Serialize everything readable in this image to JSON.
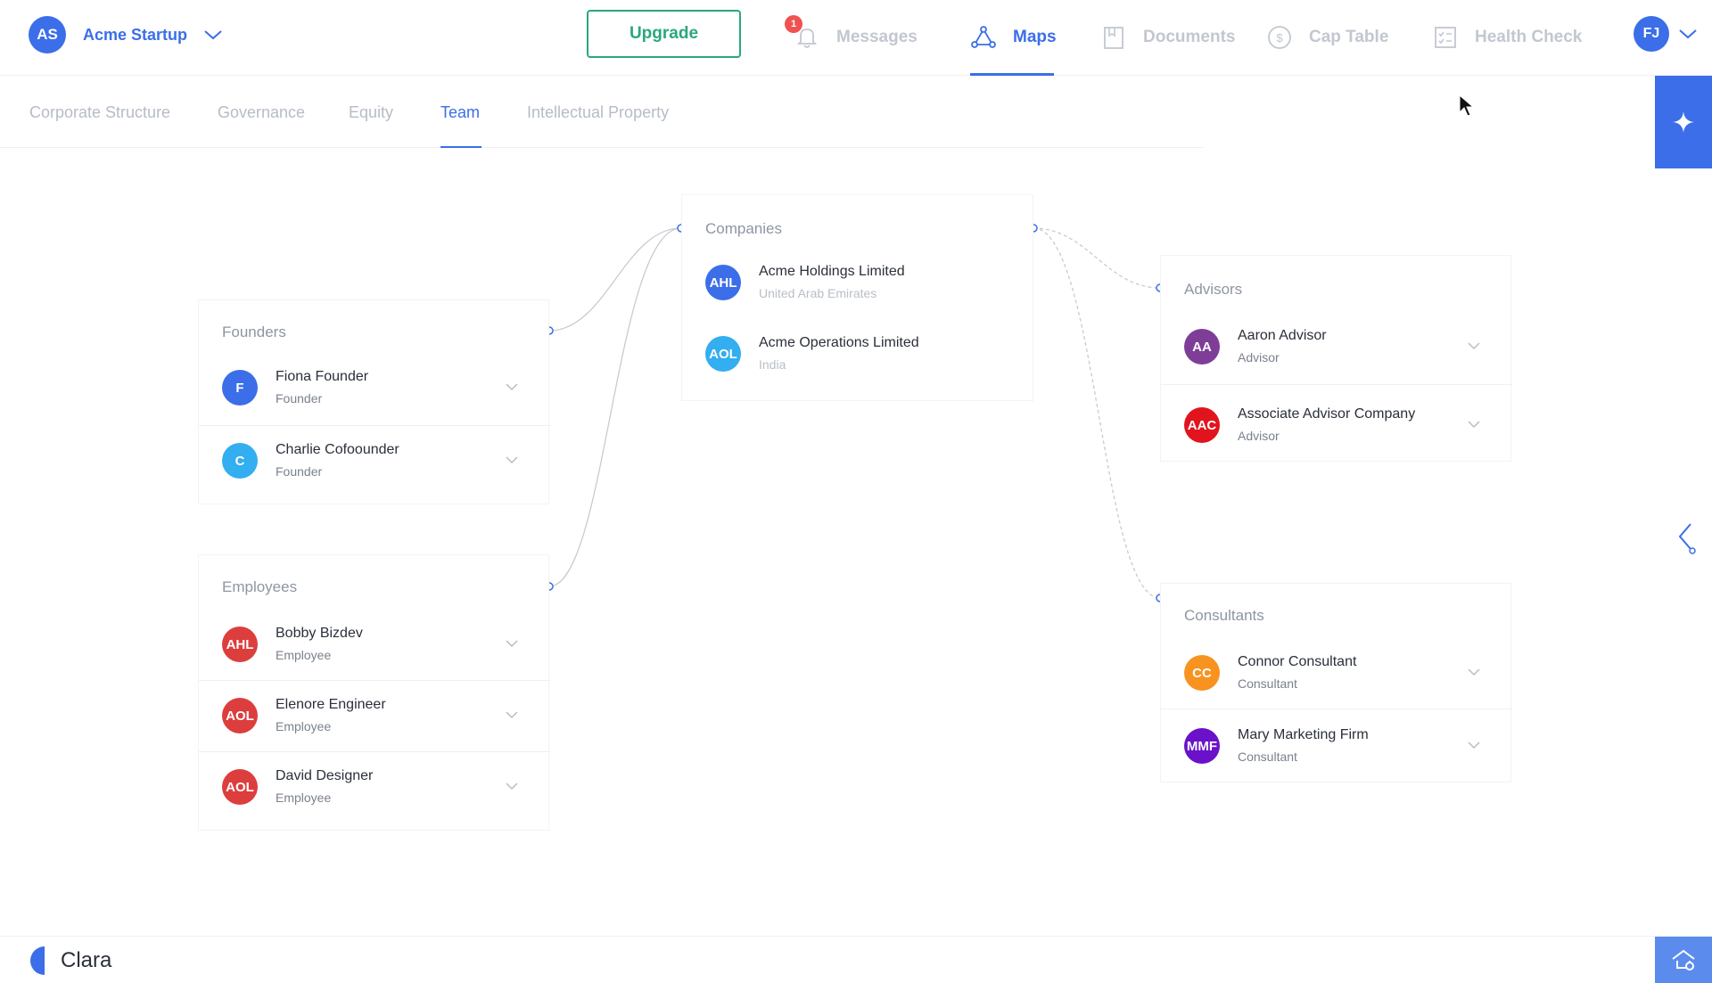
{
  "startup": {
    "initials": "AS",
    "name": "Acme Startup",
    "avatar_color": "#3b6ee8"
  },
  "header": {
    "upgrade_label": "Upgrade",
    "nav": [
      {
        "label": "Messages",
        "icon": "bell-icon",
        "badge": "1"
      },
      {
        "label": "Maps",
        "icon": "maps-icon",
        "active": true
      },
      {
        "label": "Documents",
        "icon": "document-icon"
      },
      {
        "label": "Cap Table",
        "icon": "dollar-icon"
      },
      {
        "label": "Health Check",
        "icon": "checklist-icon"
      }
    ],
    "user_initials": "FJ"
  },
  "subtabs": [
    {
      "label": "Corporate Structure"
    },
    {
      "label": "Governance"
    },
    {
      "label": "Equity"
    },
    {
      "label": "Team",
      "active": true
    },
    {
      "label": "Intellectual Property"
    }
  ],
  "companies": {
    "title": "Companies",
    "items": [
      {
        "initials": "AHL",
        "name": "Acme Holdings Limited",
        "sub": "United Arab Emirates",
        "color": "#3b6ee8"
      },
      {
        "initials": "AOL",
        "name": "Acme Operations Limited",
        "sub": "India",
        "color": "#33aef0"
      }
    ]
  },
  "founders": {
    "title": "Founders",
    "items": [
      {
        "initials": "F",
        "name": "Fiona Founder",
        "role": "Founder",
        "color": "#3b6ee8"
      },
      {
        "initials": "C",
        "name": "Charlie Cofoounder",
        "role": "Founder",
        "color": "#33aef0"
      }
    ]
  },
  "employees": {
    "title": "Employees",
    "items": [
      {
        "initials": "AHL",
        "name": "Bobby Bizdev",
        "role": "Employee",
        "color": "#dc3e3e"
      },
      {
        "initials": "AOL",
        "name": "Elenore Engineer",
        "role": "Employee",
        "color": "#dc3e3e"
      },
      {
        "initials": "AOL",
        "name": "David Designer",
        "role": "Employee",
        "color": "#dc3e3e"
      }
    ]
  },
  "advisors": {
    "title": "Advisors",
    "items": [
      {
        "initials": "AA",
        "name": "Aaron Advisor",
        "role": "Advisor",
        "color": "#7e3e98"
      },
      {
        "initials": "AAC",
        "name": "Associate Advisor Company",
        "role": "Advisor",
        "color": "#e1141e"
      }
    ]
  },
  "consultants": {
    "title": "Consultants",
    "items": [
      {
        "initials": "CC",
        "name": "Connor Consultant",
        "role": "Consultant",
        "color": "#f7931e"
      },
      {
        "initials": "MMF",
        "name": "Mary Marketing Firm",
        "role": "Consultant",
        "color": "#6a11c9"
      }
    ]
  },
  "footer": {
    "brand": "Clara"
  },
  "colors": {
    "accent": "#3b6ee8",
    "upgrade": "#2aa77d",
    "badge": "#ef5350",
    "line": "#c9cbd3"
  }
}
